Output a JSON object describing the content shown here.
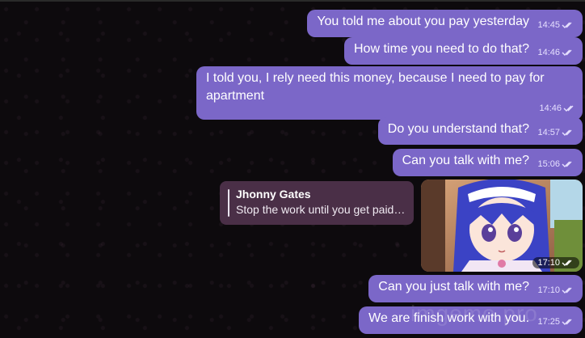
{
  "messages": [
    {
      "text": "You told me about you pay yesterday",
      "time": "14:45"
    },
    {
      "text": "How time you need to do that?",
      "time": "14:46"
    },
    {
      "text": "I told you, I rely need this money, because I need to pay for apartment",
      "time": "14:46"
    },
    {
      "text": "Do you understand that?",
      "time": "14:57"
    },
    {
      "text": "Can you talk with me?",
      "time": "15:06"
    },
    {
      "text": "Can you just talk with me?",
      "time": "17:10"
    },
    {
      "text": "We are finish work with you.",
      "time": "17:25"
    }
  ],
  "reply_card": {
    "name": "Jhonny Gates",
    "text": "Stop the work until you get paid ..."
  },
  "photo_message": {
    "time": "17:10"
  },
  "watermark": "imgemo.pro",
  "colors": {
    "bubble": "#7b67c8",
    "reply_card": "#4a2f47",
    "background": "#0d0a0d"
  }
}
